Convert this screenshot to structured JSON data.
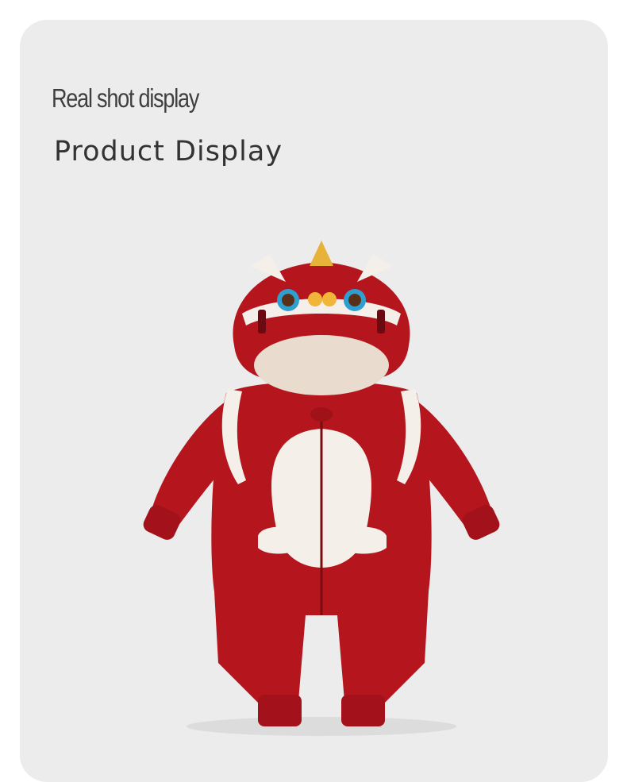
{
  "header": {
    "subtitle": "Real shot display",
    "title": "Product Display"
  },
  "photo": {
    "subject": "red-lion-hooded-baby-romper",
    "colors": {
      "background": "#ececec",
      "fabric": "#b5161d",
      "fleece": "#f4efe8",
      "accent": "#e7b23a"
    }
  }
}
